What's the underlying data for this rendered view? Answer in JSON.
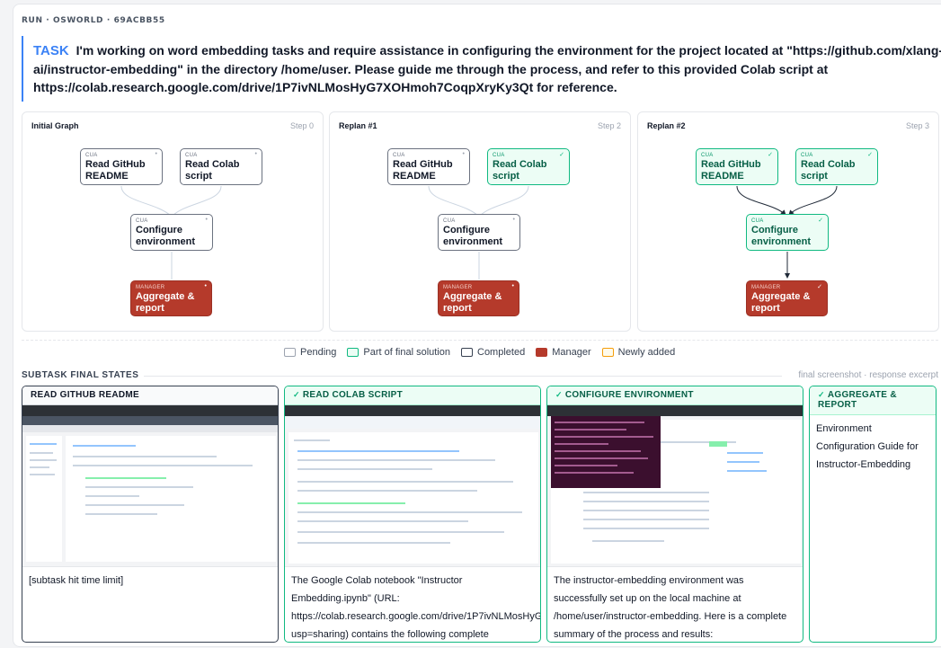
{
  "run_id": "RUN · OSWORLD · 69ACBB55",
  "task": {
    "label": "TASK",
    "text": "I'm working on word embedding tasks and require assistance in configuring the environment for the project located at \"https://github.com/xlang-ai/instructor-embedding\" in the directory /home/user. Please guide me through the process, and refer to this provided Colab script at https://colab.research.google.com/drive/1P7ivNLMosHyG7XOHmoh7CoqpXryKy3Qt for reference."
  },
  "panels": [
    {
      "title": "Initial Graph",
      "step": "Step 0",
      "nodes": [
        {
          "type": "CUA",
          "label": "Read GitHub README",
          "mark": "•",
          "state": "pending"
        },
        {
          "type": "CUA",
          "label": "Read Colab script",
          "mark": "•",
          "state": "pending"
        },
        {
          "type": "CUA",
          "label": "Configure environment",
          "mark": "•",
          "state": "pending"
        },
        {
          "type": "MANAGER",
          "label": "Aggregate & report",
          "mark": "•",
          "state": "manager"
        }
      ]
    },
    {
      "title": "Replan #1",
      "step": "Step 2",
      "nodes": [
        {
          "type": "CUA",
          "label": "Read GitHub README",
          "mark": "•",
          "state": "pending"
        },
        {
          "type": "CUA",
          "label": "Read Colab script",
          "mark": "✓",
          "state": "done"
        },
        {
          "type": "CUA",
          "label": "Configure environment",
          "mark": "•",
          "state": "pending"
        },
        {
          "type": "MANAGER",
          "label": "Aggregate & report",
          "mark": "•",
          "state": "manager"
        }
      ]
    },
    {
      "title": "Replan #2",
      "step": "Step 3",
      "nodes": [
        {
          "type": "CUA",
          "label": "Read GitHub README",
          "mark": "✓",
          "state": "done"
        },
        {
          "type": "CUA",
          "label": "Read Colab script",
          "mark": "✓",
          "state": "done"
        },
        {
          "type": "CUA",
          "label": "Configure environment",
          "mark": "✓",
          "state": "done"
        },
        {
          "type": "MANAGER",
          "label": "Aggregate & report",
          "mark": "✓",
          "state": "manager"
        }
      ]
    }
  ],
  "legend": [
    {
      "label": "Pending",
      "color": "#ffffff",
      "border": "#9ca3af"
    },
    {
      "label": "Part of final solution",
      "color": "#ecfdf5",
      "border": "#10b981"
    },
    {
      "label": "Completed",
      "color": "#ffffff",
      "border": "#374151"
    },
    {
      "label": "Manager",
      "color": "#b53a2b",
      "border": "#b53a2b"
    },
    {
      "label": "Newly added",
      "color": "#fffbeb",
      "border": "#f59e0b"
    }
  ],
  "subtasks": {
    "title": "SUBTASK FINAL STATES",
    "note": "final screenshot · response excerpt",
    "cards": [
      {
        "title": "READ GITHUB README",
        "check": "",
        "text": "[subtask hit time limit]"
      },
      {
        "title": "READ COLAB SCRIPT",
        "check": "✓",
        "text": "The Google Colab notebook \"Instructor Embedding.ipynb\" (URL: https://colab.research.google.com/drive/1P7ivNLMosHyG7XOHmoh7CoqpXryKy3Qt?usp=sharing) contains the following complete sequence of setup commands:"
      },
      {
        "title": "CONFIGURE ENVIRONMENT",
        "check": "✓",
        "text": "The instructor-embedding environment was successfully set up on the local machine at /home/user/instructor-embedding. Here is a complete summary of the process and results:"
      },
      {
        "title": "AGGREGATE & REPORT",
        "check": "✓",
        "text": "Environment Configuration Guide for Instructor-Embedding"
      }
    ]
  }
}
